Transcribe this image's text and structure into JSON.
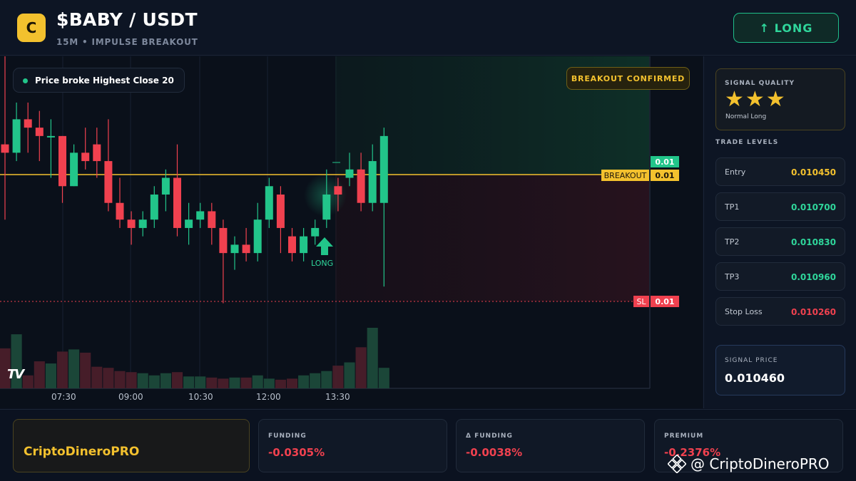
{
  "header": {
    "logo_letter": "C",
    "title": "$BABY / USDT",
    "subtitle": "15M • IMPULSE BREAKOUT",
    "long_button": "↑ LONG"
  },
  "chart": {
    "status_pill": "Price broke Highest Close 20",
    "breakout_badge": "BREAKOUT CONFIRMED",
    "tag_current": "0.01",
    "breakout_label": "BREAKOUT",
    "tag_breakout": "0.01",
    "sl_label": "SL",
    "tag_sl": "0.01",
    "marker_label": "LONG",
    "tv_logo": "TV",
    "time_labels": [
      "07:30",
      "09:00",
      "10:30",
      "12:00",
      "13:30"
    ]
  },
  "chart_data": {
    "type": "candlestick",
    "title": "",
    "xlabel": "",
    "ylabel": "",
    "x_ticks": [
      "07:30",
      "09:00",
      "10:30",
      "12:00",
      "13:30"
    ],
    "breakout_level": 0.01045,
    "stop_loss": 0.01026,
    "ylim": [
      0.01024,
      0.01054
    ],
    "candles": [
      [
        0.01045,
        0.01044,
        0.01056,
        0.01036
      ],
      [
        0.01044,
        0.01048,
        0.0105,
        0.01043
      ],
      [
        0.01048,
        0.01047,
        0.0105,
        0.01044
      ],
      [
        0.01047,
        0.01046,
        0.01049,
        0.01043
      ],
      [
        0.01046,
        0.01046,
        0.01048,
        0.01041
      ],
      [
        0.01046,
        0.0104,
        0.01046,
        0.01038
      ],
      [
        0.0104,
        0.01044,
        0.01045,
        0.0104
      ],
      [
        0.01044,
        0.01043,
        0.01047,
        0.01042
      ],
      [
        0.01045,
        0.01043,
        0.01047,
        0.01041
      ],
      [
        0.01043,
        0.01038,
        0.01048,
        0.01037
      ],
      [
        0.01038,
        0.01036,
        0.01041,
        0.01035
      ],
      [
        0.01036,
        0.01035,
        0.01037,
        0.01033
      ],
      [
        0.01035,
        0.01036,
        0.01037,
        0.01034
      ],
      [
        0.01036,
        0.01039,
        0.0104,
        0.01035
      ],
      [
        0.01039,
        0.01041,
        0.01042,
        0.01037
      ],
      [
        0.01041,
        0.01035,
        0.01045,
        0.01034
      ],
      [
        0.01035,
        0.01036,
        0.01038,
        0.01033
      ],
      [
        0.01036,
        0.01037,
        0.01038,
        0.01035
      ],
      [
        0.01037,
        0.01035,
        0.01038,
        0.01033
      ],
      [
        0.01035,
        0.01032,
        0.01036,
        0.01026
      ],
      [
        0.01032,
        0.01033,
        0.01034,
        0.0103
      ],
      [
        0.01033,
        0.01032,
        0.01035,
        0.01031
      ],
      [
        0.01032,
        0.01036,
        0.01038,
        0.01031
      ],
      [
        0.01036,
        0.0104,
        0.01041,
        0.01035
      ],
      [
        0.01039,
        0.01035,
        0.0104,
        0.01032
      ],
      [
        0.01034,
        0.01032,
        0.01035,
        0.01031
      ],
      [
        0.01032,
        0.01034,
        0.01035,
        0.01031
      ],
      [
        0.01034,
        0.01035,
        0.01036,
        0.01033
      ],
      [
        0.01036,
        0.01039,
        0.01042,
        0.01035
      ],
      [
        0.0104,
        0.01039,
        0.01041,
        0.01037
      ],
      [
        0.01041,
        0.01042,
        0.01044,
        0.0104
      ],
      [
        0.01042,
        0.01038,
        0.01044,
        0.01037
      ],
      [
        0.01038,
        0.01043,
        0.01045,
        0.01037
      ],
      [
        0.01038,
        0.01046,
        0.01047,
        0.01028
      ]
    ],
    "volume": [
      37,
      50,
      12,
      25,
      23,
      34,
      36,
      33,
      20,
      19,
      16,
      15,
      14,
      12,
      14,
      15,
      11,
      11,
      10,
      9,
      10,
      10,
      12,
      9,
      8,
      9,
      12,
      14,
      16,
      21,
      24,
      38,
      56,
      19
    ]
  },
  "sidebar": {
    "quality_title": "SIGNAL QUALITY",
    "stars": "★★★",
    "quality_sub": "Normal Long",
    "levels_title": "TRADE LEVELS",
    "levels": [
      {
        "label": "Entry",
        "value": "0.010450",
        "color": "#f3c12e"
      },
      {
        "label": "TP1",
        "value": "0.010700",
        "color": "#2fd69b"
      },
      {
        "label": "TP2",
        "value": "0.010830",
        "color": "#2fd69b"
      },
      {
        "label": "TP3",
        "value": "0.010960",
        "color": "#2fd69b"
      },
      {
        "label": "Stop Loss",
        "value": "0.010260",
        "color": "#f0414f"
      }
    ],
    "signal_title": "SIGNAL PRICE",
    "signal_value": "0.010460"
  },
  "bottom": {
    "brand": "CriptoDineroPRO",
    "stats": [
      {
        "title": "FUNDING",
        "value": "-0.0305%"
      },
      {
        "title": "Δ FUNDING",
        "value": "-0.0038%"
      },
      {
        "title": "PREMIUM",
        "value": "-0.2376%"
      }
    ],
    "watermark": "@ CriptoDineroPRO"
  },
  "colors": {
    "up": "#22c58a",
    "down": "#f0414f",
    "accent": "#f3c12e",
    "background": "#0b1220"
  }
}
